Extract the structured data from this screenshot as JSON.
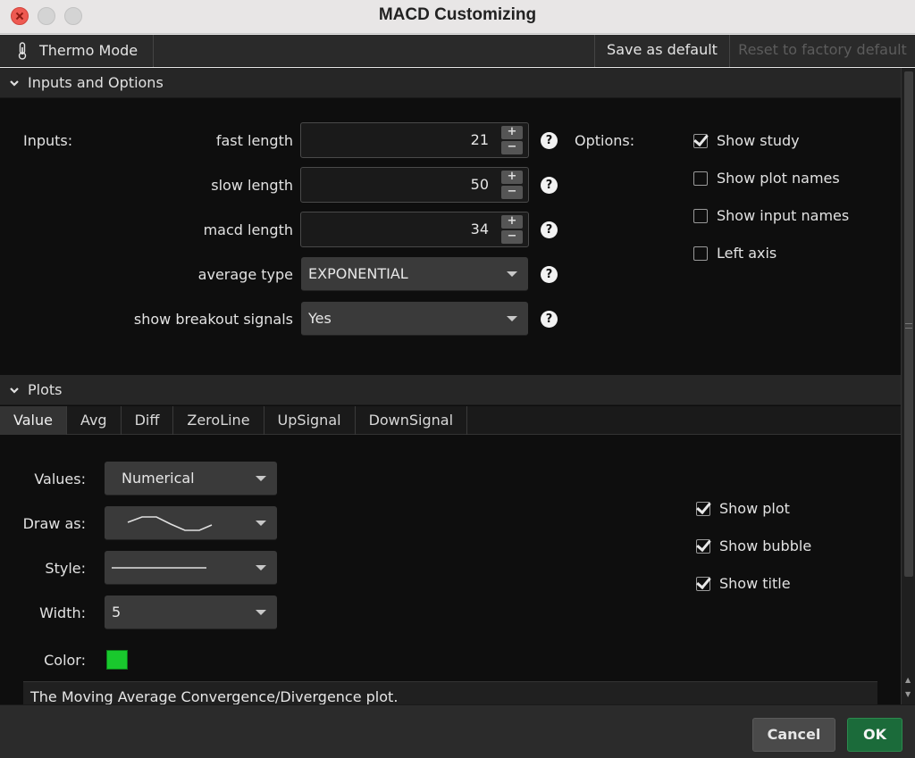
{
  "window": {
    "title": "MACD Customizing"
  },
  "toolbar": {
    "thermo_label": "Thermo Mode",
    "save_default_label": "Save as default",
    "reset_default_label": "Reset to factory default"
  },
  "inputs_section": {
    "header": "Inputs and Options",
    "inputs_label": "Inputs:",
    "options_label": "Options:",
    "fields": [
      {
        "label": "fast length",
        "value": "21"
      },
      {
        "label": "slow length",
        "value": "50"
      },
      {
        "label": "macd length",
        "value": "34"
      },
      {
        "label": "average type",
        "value": "EXPONENTIAL"
      },
      {
        "label": "show breakout signals",
        "value": "Yes"
      }
    ],
    "stepper": {
      "plus": "+",
      "minus": "−"
    },
    "help_glyph": "?",
    "options": [
      {
        "label": "Show study",
        "checked": true
      },
      {
        "label": "Show plot names",
        "checked": false
      },
      {
        "label": "Show input names",
        "checked": false
      },
      {
        "label": "Left axis",
        "checked": false
      }
    ]
  },
  "plots_section": {
    "header": "Plots",
    "tabs": [
      "Value",
      "Avg",
      "Diff",
      "ZeroLine",
      "UpSignal",
      "DownSignal"
    ],
    "active_tab": "Value",
    "values_label": "Values:",
    "values_value": "Numerical",
    "draw_as_label": "Draw as:",
    "style_label": "Style:",
    "width_label": "Width:",
    "width_value": "5",
    "color_label": "Color:",
    "color_value": "#19c82d",
    "checks": [
      {
        "label": "Show plot",
        "checked": true
      },
      {
        "label": "Show bubble",
        "checked": true
      },
      {
        "label": "Show title",
        "checked": true
      }
    ],
    "description": "The Moving Average Convergence/Divergence plot."
  },
  "footer": {
    "cancel_label": "Cancel",
    "ok_label": "OK"
  },
  "colors": {
    "background": "#0e0e0e",
    "ok_button": "#1b6b3a",
    "plot_color": "#19c82d"
  }
}
